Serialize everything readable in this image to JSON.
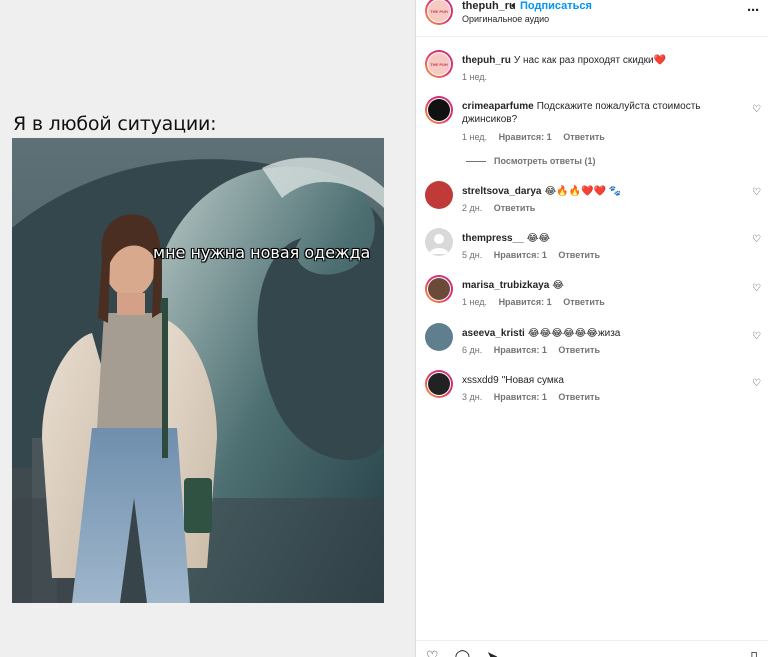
{
  "media": {
    "caption": "Я в любой ситуации:",
    "overlay_text": "мне нужна новая одежда"
  },
  "post": {
    "username": "thepuh_ru",
    "separator": "•",
    "follow_label": "Подписаться",
    "audio_label": "Оригинальное аудио",
    "more_icon": "more-horizontal-icon",
    "avatar_brand": "THE PUH"
  },
  "owner_caption": {
    "username": "thepuh_ru",
    "text": "У нас как раз проходят скидки",
    "emoji": "❤️",
    "time": "1 нед."
  },
  "comments": [
    {
      "username": "crimeaparfume",
      "text": "Подскажите пожалуйста стоимость джинсиков?",
      "time": "1 нед.",
      "likes": "Нравится: 1",
      "reply": "Ответить",
      "view_replies": "Посмотреть ответы (1)"
    },
    {
      "username": "streltsova_darya",
      "text": "😂🔥🔥❤️❤️ 🐾",
      "time": "2 дн.",
      "likes": "",
      "reply": "Ответить"
    },
    {
      "username": "thempress__",
      "text": "😂😂",
      "time": "5 дн.",
      "likes": "Нравится: 1",
      "reply": "Ответить"
    },
    {
      "username": "marisa_trubizkaya",
      "text": "😂",
      "time": "1 нед.",
      "likes": "Нравится: 1",
      "reply": "Ответить"
    },
    {
      "username": "aseeva_kristi",
      "text": "😂😂😂😂😂😂жиза",
      "time": "6 дн.",
      "likes": "Нравится: 1",
      "reply": "Ответить"
    },
    {
      "username": "xssxdd9",
      "text": "\"Новая сумка",
      "time": "3 дн.",
      "likes": "Нравится: 1",
      "reply": "Ответить"
    }
  ],
  "icons": {
    "heart": "heart-outline-icon",
    "comment": "comment-icon",
    "share": "share-icon",
    "bookmark": "bookmark-icon"
  },
  "colors": {
    "accent": "#0095f6",
    "text": "#262626",
    "muted": "#737373",
    "like_red": "#ed4956"
  }
}
